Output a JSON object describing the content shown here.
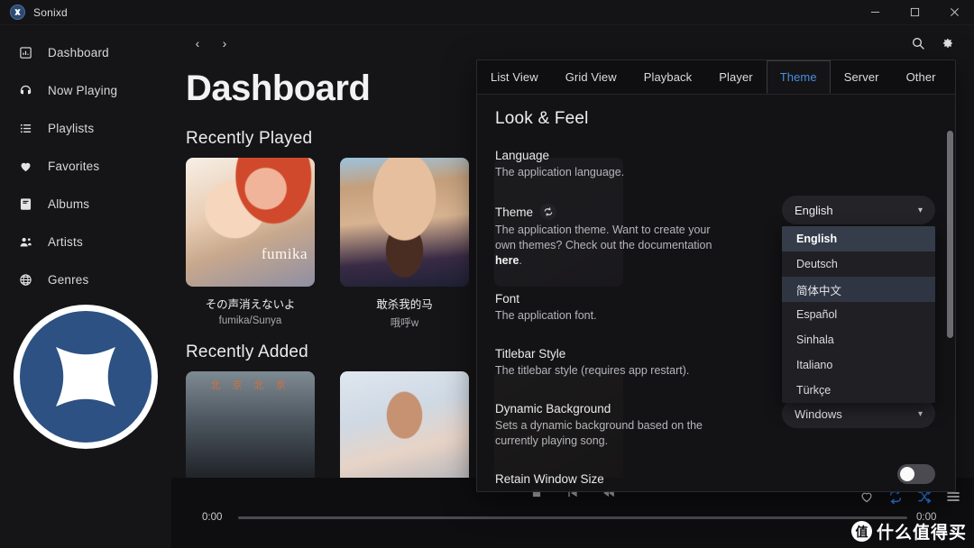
{
  "window": {
    "app_title": "Sonixd",
    "minimize_label": "–",
    "maximize_label": "□",
    "close_label": "✕"
  },
  "sidebar": {
    "items": [
      {
        "label": "Dashboard",
        "icon": "dashboard-icon"
      },
      {
        "label": "Now Playing",
        "icon": "headphones-icon"
      },
      {
        "label": "Playlists",
        "icon": "list-icon"
      },
      {
        "label": "Favorites",
        "icon": "heart-icon"
      },
      {
        "label": "Albums",
        "icon": "book-icon"
      },
      {
        "label": "Artists",
        "icon": "people-icon"
      },
      {
        "label": "Genres",
        "icon": "globe-icon"
      }
    ]
  },
  "topnav": {
    "back_label": "‹",
    "forward_label": "›",
    "search_icon": "search-icon",
    "settings_icon": "gear-icon"
  },
  "main": {
    "page_title": "Dashboard",
    "sections": [
      {
        "title": "Recently Played",
        "cards": [
          {
            "name": "その声消えないよ",
            "artist": "fumika/Sunya",
            "art": "art-fumika"
          },
          {
            "name": "敢杀我的马",
            "artist": "哦呼w",
            "art": "art-man"
          },
          {
            "name": "",
            "artist": "",
            "art": "art-pink"
          }
        ]
      },
      {
        "title": "Recently Added",
        "cards": [
          {
            "name": "",
            "artist": "",
            "art": "art-beijing"
          },
          {
            "name": "",
            "artist": "",
            "art": "art-girl2"
          },
          {
            "name": "",
            "artist": "",
            "art": "art-gold"
          }
        ]
      }
    ]
  },
  "player": {
    "time_elapsed": "0:00",
    "time_total": "0:00",
    "controls": [
      {
        "name": "stop-button",
        "icon": "stop-icon"
      },
      {
        "name": "previous-button",
        "icon": "skip-previous-icon"
      },
      {
        "name": "rewind-button",
        "icon": "rewind-icon"
      }
    ],
    "right_icons": [
      {
        "name": "favorite-button",
        "icon": "heart-outline-icon",
        "color": "#dcdcdf"
      },
      {
        "name": "repeat-button",
        "icon": "repeat-icon",
        "color": "#2f7ff0"
      },
      {
        "name": "shuffle-button",
        "icon": "shuffle-icon",
        "color": "#2f7ff0"
      },
      {
        "name": "queue-button",
        "icon": "queue-icon",
        "color": "#dcdcdf"
      }
    ]
  },
  "settings": {
    "tabs": [
      {
        "label": "List View",
        "active": false
      },
      {
        "label": "Grid View",
        "active": false
      },
      {
        "label": "Playback",
        "active": false
      },
      {
        "label": "Player",
        "active": false
      },
      {
        "label": "Theme",
        "active": true
      },
      {
        "label": "Server",
        "active": false
      },
      {
        "label": "Other",
        "active": false
      }
    ],
    "heading": "Look & Feel",
    "rows": {
      "language": {
        "label": "Language",
        "description": "The application language.",
        "value": "English"
      },
      "theme": {
        "label": "Theme",
        "refresh_icon": "refresh-icon",
        "description_1": "The application theme. Want to create your",
        "description_2": "own themes? Check out the documentation",
        "link_text": "here",
        "description_3": "."
      },
      "font": {
        "label": "Font",
        "description": "The application font."
      },
      "titlebar": {
        "label": "Titlebar Style",
        "description": "The titlebar style (requires app restart).",
        "value": "Windows"
      },
      "dynamic_background": {
        "label": "Dynamic Background",
        "description_1": "Sets a dynamic background based on the",
        "description_2": "currently playing song.",
        "toggle_state": "off"
      },
      "retain_window_size": {
        "label": "Retain Window Size"
      }
    },
    "language_options": [
      {
        "label": "English",
        "state": "selected"
      },
      {
        "label": "Deutsch",
        "state": "normal"
      },
      {
        "label": "简体中文",
        "state": "hovered"
      },
      {
        "label": "Español",
        "state": "normal"
      },
      {
        "label": "Sinhala",
        "state": "normal"
      },
      {
        "label": "Italiano",
        "state": "normal"
      },
      {
        "label": "Türkçe",
        "state": "normal"
      }
    ]
  },
  "watermark": {
    "brand_mark": "值",
    "brand_text": "什么值得买"
  },
  "colors": {
    "accent_blue": "#4a8de0",
    "player_blue": "#2f7ff0",
    "panel_bg": "#141417",
    "sidebar_bg": "#151517"
  }
}
